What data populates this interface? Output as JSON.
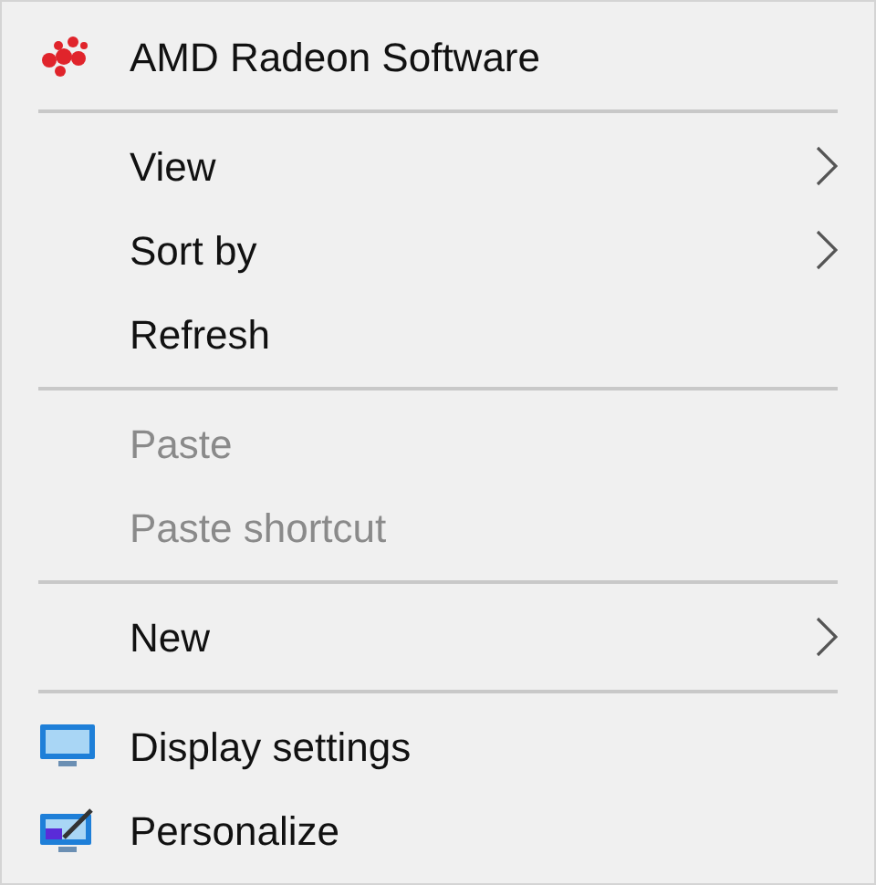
{
  "menu": {
    "sections": [
      {
        "items": [
          {
            "label": "AMD Radeon Software",
            "kind": "amd",
            "submenu": false,
            "disabled": false
          }
        ]
      },
      {
        "items": [
          {
            "label": "View",
            "kind": "plain",
            "submenu": true,
            "disabled": false
          },
          {
            "label": "Sort by",
            "kind": "plain",
            "submenu": true,
            "disabled": false
          },
          {
            "label": "Refresh",
            "kind": "plain",
            "submenu": false,
            "disabled": false
          }
        ]
      },
      {
        "items": [
          {
            "label": "Paste",
            "kind": "plain",
            "submenu": false,
            "disabled": true
          },
          {
            "label": "Paste shortcut",
            "kind": "plain",
            "submenu": false,
            "disabled": true
          }
        ]
      },
      {
        "items": [
          {
            "label": "New",
            "kind": "plain",
            "submenu": true,
            "disabled": false
          }
        ]
      },
      {
        "items": [
          {
            "label": "Display settings",
            "kind": "display",
            "submenu": false,
            "disabled": false
          },
          {
            "label": "Personalize",
            "kind": "personalize",
            "submenu": false,
            "disabled": false
          }
        ]
      }
    ]
  }
}
